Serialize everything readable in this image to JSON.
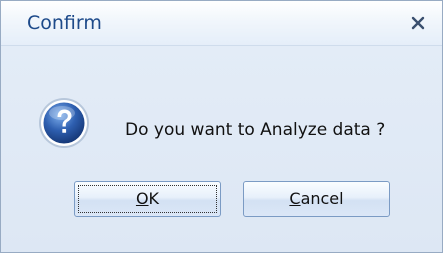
{
  "dialog": {
    "title": "Confirm",
    "close_glyph": "x",
    "message": "Do you want to Analyze data ?",
    "icon": "question-icon",
    "buttons": {
      "ok": {
        "mnemonic": "O",
        "rest": "K"
      },
      "cancel": {
        "mnemonic": "C",
        "rest": "ancel"
      }
    }
  },
  "colors": {
    "title_text": "#1d4a8a",
    "body_background": "#e3ecf7",
    "icon_blue": "#2e5fb0"
  }
}
